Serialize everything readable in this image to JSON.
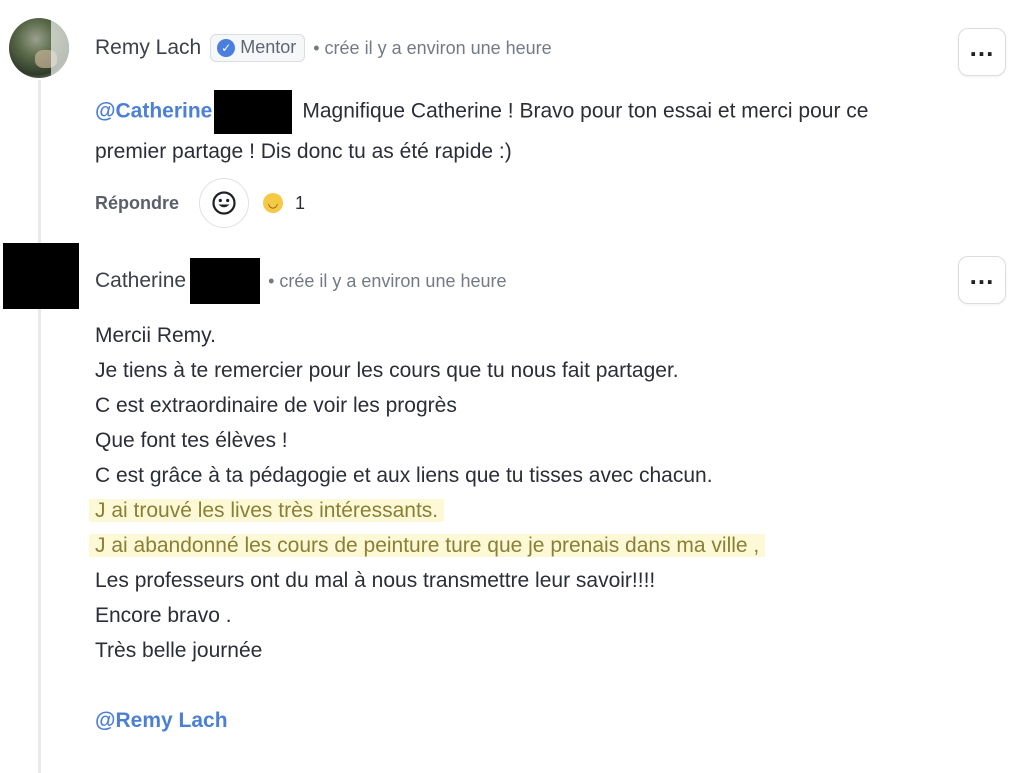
{
  "comments": [
    {
      "author": "Remy Lach",
      "badge": "Mentor",
      "meta": "• crée il y a environ une heure",
      "mention": "@Catherine",
      "text_line1": "Magnifique Catherine ! Bravo pour ton essai et merci pour ce",
      "text_line2": "premier partage ! Dis donc tu as été rapide :)",
      "reply_label": "Répondre",
      "reaction_count": "1"
    },
    {
      "author": "Catherine",
      "meta": "• crée il y a environ une heure",
      "lines": [
        "Mercii Remy.",
        "Je tiens à te remercier pour les cours que tu nous fait partager.",
        "C est extraordinaire de voir les progrès",
        "Que font tes élèves !",
        "C est grâce  à ta pédagogie  et aux liens que tu tisses avec chacun.",
        "J ai trouvé les lives très intéressants.",
        "J ai abandonné les cours de peinture ture que je prenais dans ma ville ,",
        "Les professeurs ont du mal à nous transmettre leur savoir!!!!",
        "Encore bravo .",
        "Très belle journée"
      ],
      "mention": "@Remy Lach"
    }
  ],
  "icons": {
    "more": "more-icon",
    "react": "emoji-picker-icon",
    "verified": "verified-icon",
    "reaction_emoji": "grinning-emoji-icon"
  },
  "colors": {
    "mention": "#4c7fd6",
    "highlight_bg": "#fdf9d6",
    "highlight_text": "#8a7f35",
    "badge_check": "#4a7fe0"
  }
}
